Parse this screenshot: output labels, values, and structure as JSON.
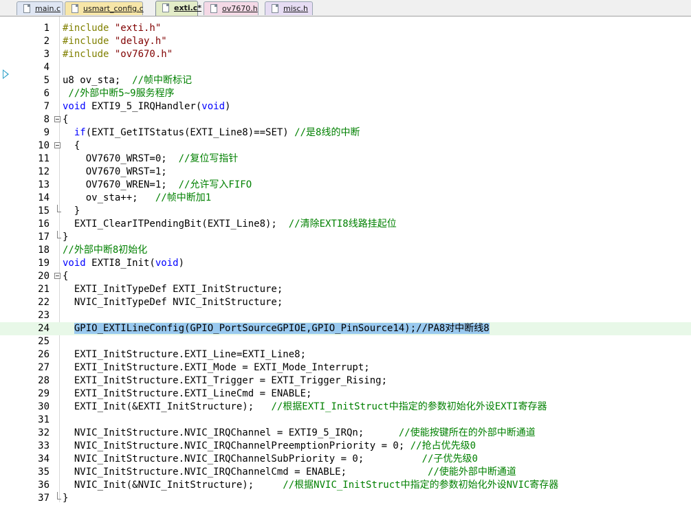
{
  "tabs": [
    {
      "label": "main.c"
    },
    {
      "label": "usmart_config.c"
    },
    {
      "label": "exti.c*"
    },
    {
      "label": "ov7670.h"
    },
    {
      "label": "misc.h"
    }
  ],
  "active_tab": "exti.c*",
  "colors": {
    "comment": "#008000",
    "keyword": "#0000ff",
    "string": "#800000",
    "preprocessor": "#808000",
    "number": "#000000",
    "selection": "#99c9ef",
    "current_line": "#e8f8e8"
  },
  "lines": [
    {
      "n": "1",
      "parts": [
        {
          "t": "#include ",
          "c": "pp"
        },
        {
          "t": "\"exti.h\"",
          "c": "str"
        }
      ]
    },
    {
      "n": "2",
      "parts": [
        {
          "t": "#include ",
          "c": "pp"
        },
        {
          "t": "\"delay.h\"",
          "c": "str"
        }
      ]
    },
    {
      "n": "3",
      "parts": [
        {
          "t": "#include ",
          "c": "pp"
        },
        {
          "t": "\"ov7670.h\"",
          "c": "str"
        }
      ]
    },
    {
      "n": "4",
      "parts": []
    },
    {
      "n": "5",
      "parts": [
        {
          "t": "u8 ov_sta;  ",
          "c": "n"
        },
        {
          "t": "//帧中断标记",
          "c": "cmt"
        }
      ]
    },
    {
      "n": "6",
      "parts": [
        {
          "t": " //外部中断5~9服务程序",
          "c": "cmt"
        }
      ]
    },
    {
      "n": "7",
      "parts": [
        {
          "t": "void",
          "c": "kw"
        },
        {
          "t": " EXTI9_5_IRQHandler(",
          "c": "n"
        },
        {
          "t": "void",
          "c": "kw"
        },
        {
          "t": ")",
          "c": "n"
        }
      ]
    },
    {
      "n": "8",
      "fold": "open",
      "parts": [
        {
          "t": "{",
          "c": "n"
        }
      ]
    },
    {
      "n": "9",
      "parts": [
        {
          "t": "  ",
          "c": "n"
        },
        {
          "t": "if",
          "c": "kw"
        },
        {
          "t": "(EXTI_GetITStatus(EXTI_Line8)==SET) ",
          "c": "n"
        },
        {
          "t": "//是8线的中断",
          "c": "cmt"
        }
      ]
    },
    {
      "n": "10",
      "fold": "open",
      "parts": [
        {
          "t": "  {",
          "c": "n"
        }
      ]
    },
    {
      "n": "11",
      "parts": [
        {
          "t": "    OV7670_WRST=0;  ",
          "c": "n"
        },
        {
          "t": "//复位写指针",
          "c": "cmt"
        }
      ]
    },
    {
      "n": "12",
      "parts": [
        {
          "t": "    OV7670_WRST=1;",
          "c": "n"
        }
      ]
    },
    {
      "n": "13",
      "parts": [
        {
          "t": "    OV7670_WREN=1;  ",
          "c": "n"
        },
        {
          "t": "//允许写入FIFO",
          "c": "cmt"
        }
      ]
    },
    {
      "n": "14",
      "parts": [
        {
          "t": "    ov_sta++;   ",
          "c": "n"
        },
        {
          "t": "//帧中断加1",
          "c": "cmt"
        }
      ]
    },
    {
      "n": "15",
      "fold": "end",
      "parts": [
        {
          "t": "  }",
          "c": "n"
        }
      ]
    },
    {
      "n": "16",
      "parts": [
        {
          "t": "  EXTI_ClearITPendingBit(EXTI_Line8);  ",
          "c": "n"
        },
        {
          "t": "//清除EXTI8线路挂起位",
          "c": "cmt"
        }
      ]
    },
    {
      "n": "17",
      "fold": "end",
      "parts": [
        {
          "t": "}",
          "c": "n"
        }
      ]
    },
    {
      "n": "18",
      "parts": [
        {
          "t": "//外部中断8初始化",
          "c": "cmt"
        }
      ]
    },
    {
      "n": "19",
      "parts": [
        {
          "t": "void",
          "c": "kw"
        },
        {
          "t": " EXTI8_Init(",
          "c": "n"
        },
        {
          "t": "void",
          "c": "kw"
        },
        {
          "t": ")",
          "c": "n"
        }
      ]
    },
    {
      "n": "20",
      "fold": "open",
      "parts": [
        {
          "t": "{",
          "c": "n"
        }
      ]
    },
    {
      "n": "21",
      "parts": [
        {
          "t": "  EXTI_InitTypeDef EXTI_InitStructure;",
          "c": "n"
        }
      ]
    },
    {
      "n": "22",
      "parts": [
        {
          "t": "  NVIC_InitTypeDef NVIC_InitStructure;",
          "c": "n"
        }
      ]
    },
    {
      "n": "23",
      "parts": []
    },
    {
      "n": "24",
      "current": true,
      "parts": [
        {
          "t": "  ",
          "c": "n"
        },
        {
          "t": "GPIO_EXTILineConfig(GPIO_PortSourceGPIOE,GPIO_PinSource14);//PA8对中断线8",
          "c": "sel"
        }
      ]
    },
    {
      "n": "25",
      "parts": []
    },
    {
      "n": "26",
      "parts": [
        {
          "t": "  EXTI_InitStructure.EXTI_Line=EXTI_Line8;",
          "c": "n"
        }
      ]
    },
    {
      "n": "27",
      "parts": [
        {
          "t": "  EXTI_InitStructure.EXTI_Mode = EXTI_Mode_Interrupt;",
          "c": "n"
        }
      ]
    },
    {
      "n": "28",
      "parts": [
        {
          "t": "  EXTI_InitStructure.EXTI_Trigger = EXTI_Trigger_Rising;",
          "c": "n"
        }
      ]
    },
    {
      "n": "29",
      "parts": [
        {
          "t": "  EXTI_InitStructure.EXTI_LineCmd = ENABLE;",
          "c": "n"
        }
      ]
    },
    {
      "n": "30",
      "parts": [
        {
          "t": "  EXTI_Init(&EXTI_InitStructure);   ",
          "c": "n"
        },
        {
          "t": "//根据EXTI_InitStruct中指定的参数初始化外设EXTI寄存器",
          "c": "cmt"
        }
      ]
    },
    {
      "n": "31",
      "parts": []
    },
    {
      "n": "32",
      "parts": [
        {
          "t": "  NVIC_InitStructure.NVIC_IRQChannel = EXTI9_5_IRQn;      ",
          "c": "n"
        },
        {
          "t": "//使能按键所在的外部中断通道",
          "c": "cmt"
        }
      ]
    },
    {
      "n": "33",
      "parts": [
        {
          "t": "  NVIC_InitStructure.NVIC_IRQChannelPreemptionPriority = 0; ",
          "c": "n"
        },
        {
          "t": "//抢占优先级0",
          "c": "cmt"
        }
      ]
    },
    {
      "n": "34",
      "parts": [
        {
          "t": "  NVIC_InitStructure.NVIC_IRQChannelSubPriority = 0;          ",
          "c": "n"
        },
        {
          "t": "//子优先级0",
          "c": "cmt"
        }
      ]
    },
    {
      "n": "35",
      "parts": [
        {
          "t": "  NVIC_InitStructure.NVIC_IRQChannelCmd = ENABLE;              ",
          "c": "n"
        },
        {
          "t": "//使能外部中断通道",
          "c": "cmt"
        }
      ]
    },
    {
      "n": "36",
      "parts": [
        {
          "t": "  NVIC_Init(&NVIC_InitStructure);     ",
          "c": "n"
        },
        {
          "t": "//根据NVIC_InitStruct中指定的参数初始化外设NVIC寄存器",
          "c": "cmt"
        }
      ]
    },
    {
      "n": "37",
      "fold": "end",
      "parts": [
        {
          "t": "}",
          "c": "n"
        }
      ]
    }
  ]
}
